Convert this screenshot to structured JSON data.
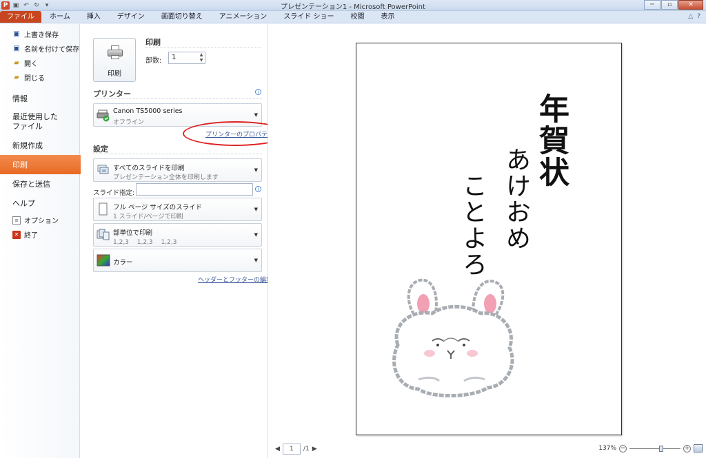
{
  "window": {
    "title": "プレゼンテーション1 - Microsoft PowerPoint",
    "minimize": "─",
    "maximize": "▫",
    "close": "✕"
  },
  "quick_access": {
    "app_icon": "P",
    "icons": [
      "save-icon",
      "undo-icon",
      "redo-icon",
      "customize-icon"
    ]
  },
  "ribbon_tabs": [
    "ファイル",
    "ホーム",
    "挿入",
    "デザイン",
    "画面切り替え",
    "アニメーション",
    "スライド ショー",
    "校閲",
    "表示"
  ],
  "ribbon_right": {
    "minimize": "△",
    "help": "?"
  },
  "backstage_menu": {
    "commands_top": [
      {
        "label": "上書き保存",
        "icon": "save-icon"
      },
      {
        "label": "名前を付けて保存",
        "icon": "save-as-icon"
      },
      {
        "label": "開く",
        "icon": "open-folder-icon"
      },
      {
        "label": "閉じる",
        "icon": "close-folder-icon"
      }
    ],
    "items": [
      "情報",
      "最近使用した\nファイル",
      "新規作成",
      "印刷",
      "保存と送信",
      "ヘルプ"
    ],
    "active_item": "印刷",
    "commands_bottom": [
      {
        "label": "オプション",
        "icon": "options-icon"
      },
      {
        "label": "終了",
        "icon": "exit-icon"
      }
    ]
  },
  "print_panel": {
    "print_button_label": "印刷",
    "heading": "印刷",
    "copies_label": "部数:",
    "copies_value": "1",
    "printer_section": "プリンター",
    "printer_name": "Canon TS5000 series",
    "printer_status": "オフライン",
    "printer_properties_link": "プリンターのプロパティ",
    "settings_section": "設定",
    "slides_range_main": "すべてのスライドを印刷",
    "slides_range_sub": "プレゼンテーション全体を印刷します",
    "slide_spec_label": "スライド指定:",
    "layout_main": "フル ページ サイズのスライド",
    "layout_sub": "1 スライド/ページで印刷",
    "collate_main": "部単位で印刷",
    "collate_sub": "1,2,3　 1,2,3　 1,2,3",
    "color_main": "カラー",
    "header_footer_link": "ヘッダーとフッターの編集",
    "annotation_color": "#e02020"
  },
  "preview": {
    "line1": "年賀状",
    "line2": "あけおめ",
    "line3": "ことよろ",
    "page_current": "1",
    "page_total": "/1",
    "zoom_percent": "137%",
    "zoom_level_fraction": 0.63
  }
}
